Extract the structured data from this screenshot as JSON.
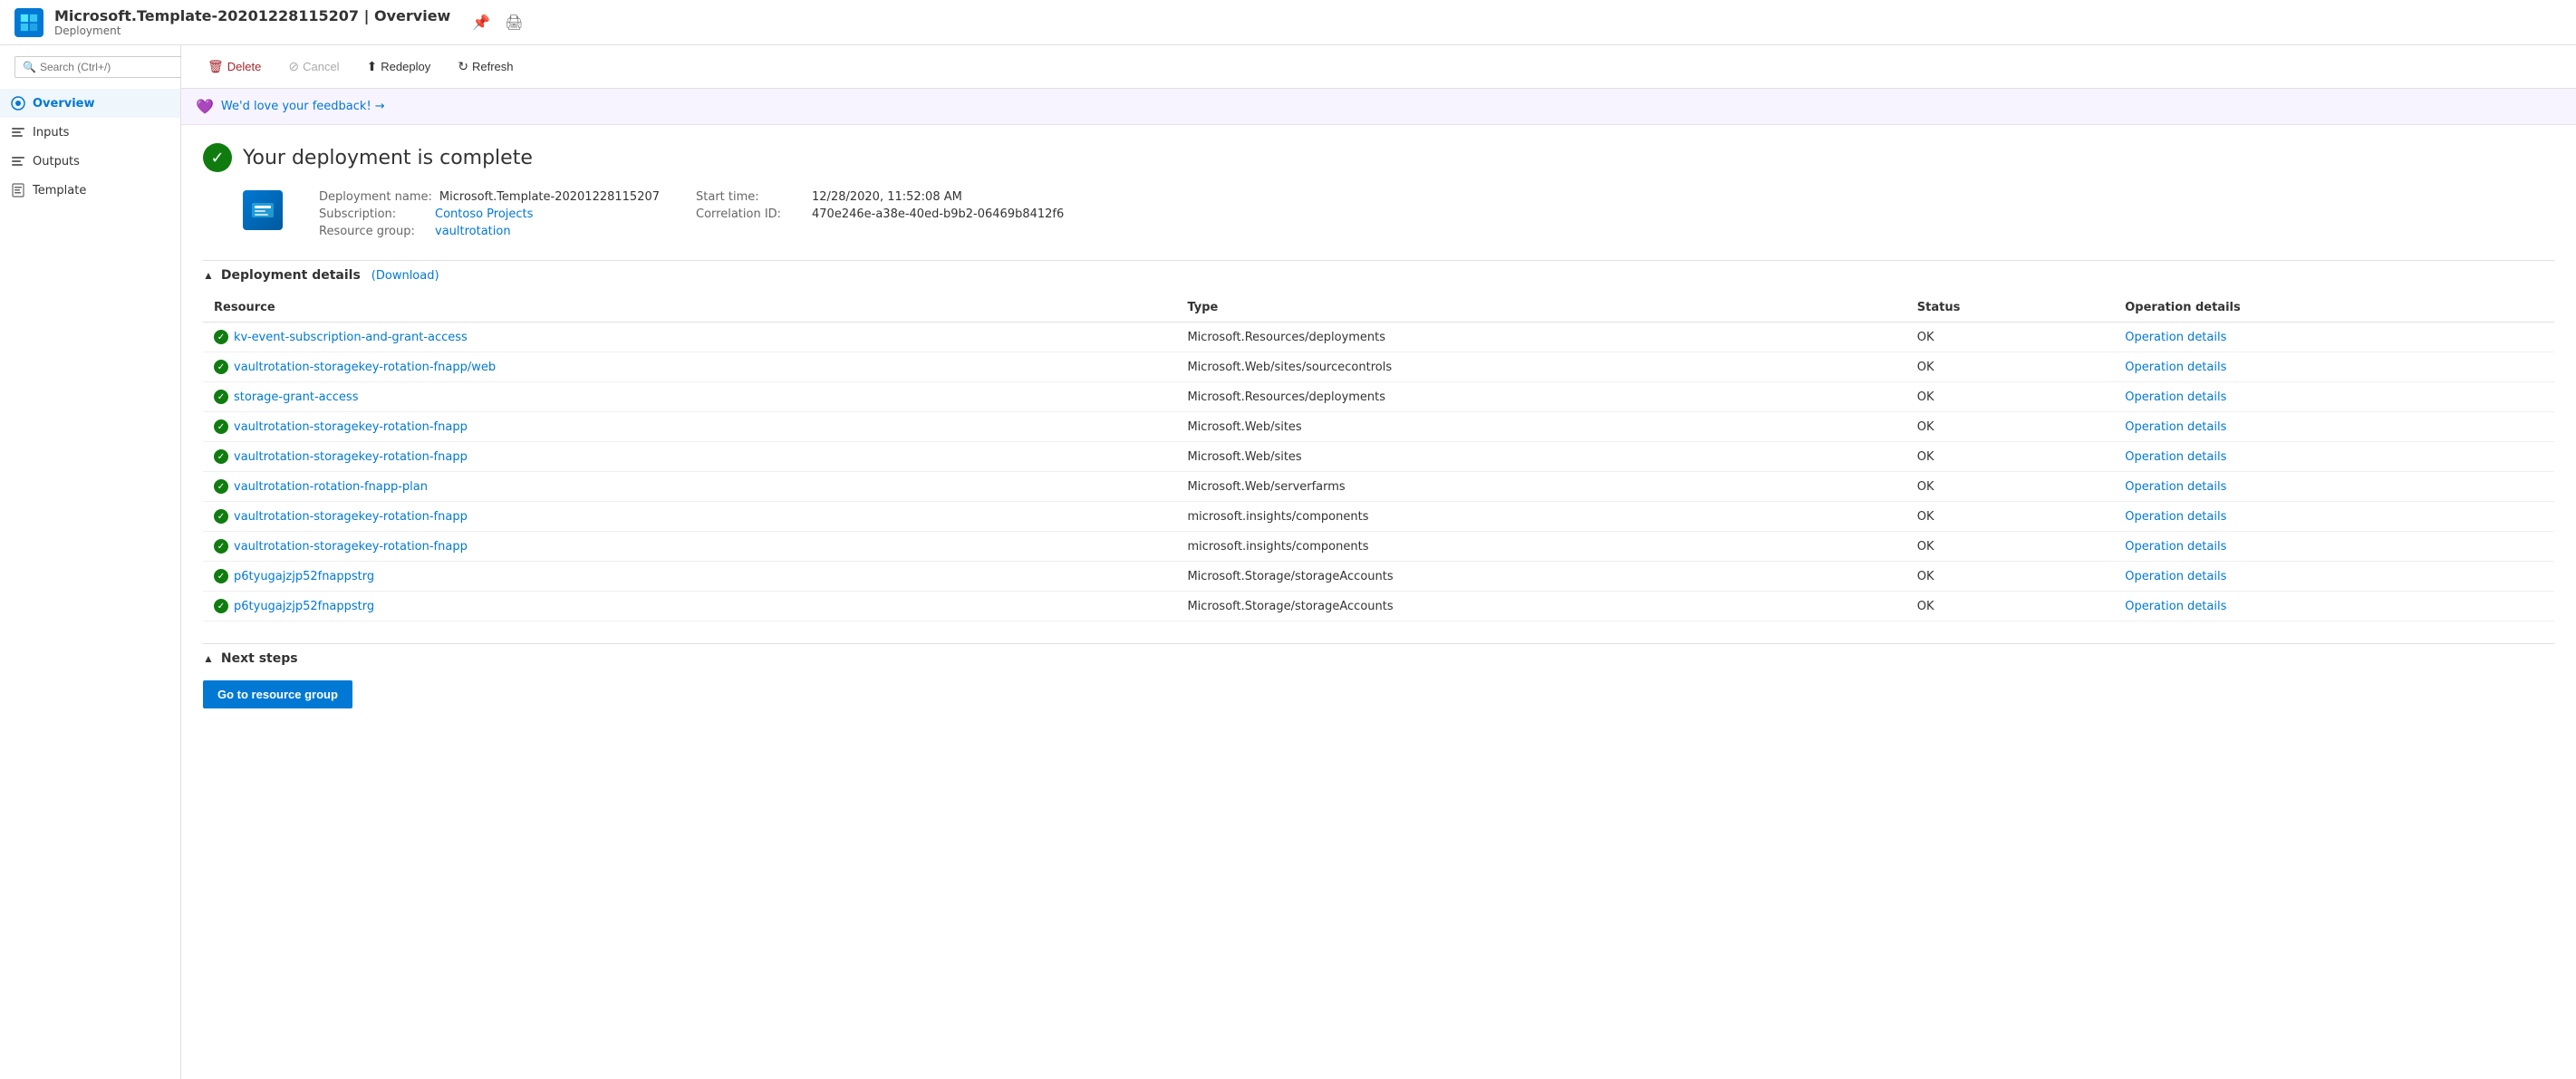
{
  "app": {
    "title": "Microsoft.Template-20201228115207 | Overview",
    "subtitle": "Deployment",
    "icon_symbol": "🔷"
  },
  "toolbar": {
    "title_prefix": "Microsoft.Template-20201228115207",
    "title_suffix": "Overview",
    "pin_label": "📌",
    "print_label": "🖨",
    "delete_label": "Delete",
    "cancel_label": "Cancel",
    "redeploy_label": "Redeploy",
    "refresh_label": "Refresh"
  },
  "sidebar": {
    "search_placeholder": "Search (Ctrl+/)",
    "items": [
      {
        "label": "Overview",
        "active": true
      },
      {
        "label": "Inputs",
        "active": false
      },
      {
        "label": "Outputs",
        "active": false
      },
      {
        "label": "Template",
        "active": false
      }
    ]
  },
  "feedback": {
    "text": "We'd love your feedback! →"
  },
  "deployment": {
    "heading": "Your deployment is complete",
    "name_label": "Deployment name:",
    "name_value": "Microsoft.Template-20201228115207",
    "subscription_label": "Subscription:",
    "subscription_value": "Contoso Projects",
    "resource_group_label": "Resource group:",
    "resource_group_value": "vaultrotation",
    "start_time_label": "Start time:",
    "start_time_value": "12/28/2020, 11:52:08 AM",
    "correlation_label": "Correlation ID:",
    "correlation_value": "470e246e-a38e-40ed-b9b2-06469b8412f6"
  },
  "deployment_details": {
    "section_title": "Deployment details",
    "download_label": "(Download)",
    "columns": [
      "Resource",
      "Type",
      "Status",
      "Operation details"
    ],
    "rows": [
      {
        "resource": "kv-event-subscription-and-grant-access",
        "type": "Microsoft.Resources/deployments",
        "status": "OK",
        "op": "Operation details"
      },
      {
        "resource": "vaultrotation-storagekey-rotation-fnapp/web",
        "type": "Microsoft.Web/sites/sourcecontrols",
        "status": "OK",
        "op": "Operation details"
      },
      {
        "resource": "storage-grant-access",
        "type": "Microsoft.Resources/deployments",
        "status": "OK",
        "op": "Operation details"
      },
      {
        "resource": "vaultrotation-storagekey-rotation-fnapp",
        "type": "Microsoft.Web/sites",
        "status": "OK",
        "op": "Operation details"
      },
      {
        "resource": "vaultrotation-storagekey-rotation-fnapp",
        "type": "Microsoft.Web/sites",
        "status": "OK",
        "op": "Operation details"
      },
      {
        "resource": "vaultrotation-rotation-fnapp-plan",
        "type": "Microsoft.Web/serverfarms",
        "status": "OK",
        "op": "Operation details"
      },
      {
        "resource": "vaultrotation-storagekey-rotation-fnapp",
        "type": "microsoft.insights/components",
        "status": "OK",
        "op": "Operation details"
      },
      {
        "resource": "vaultrotation-storagekey-rotation-fnapp",
        "type": "microsoft.insights/components",
        "status": "OK",
        "op": "Operation details"
      },
      {
        "resource": "p6tyugajzjp52fnappstrg",
        "type": "Microsoft.Storage/storageAccounts",
        "status": "OK",
        "op": "Operation details"
      },
      {
        "resource": "p6tyugajzjp52fnappstrg",
        "type": "Microsoft.Storage/storageAccounts",
        "status": "OK",
        "op": "Operation details"
      }
    ]
  },
  "next_steps": {
    "section_title": "Next steps",
    "go_to_resource_group_label": "Go to resource group"
  }
}
